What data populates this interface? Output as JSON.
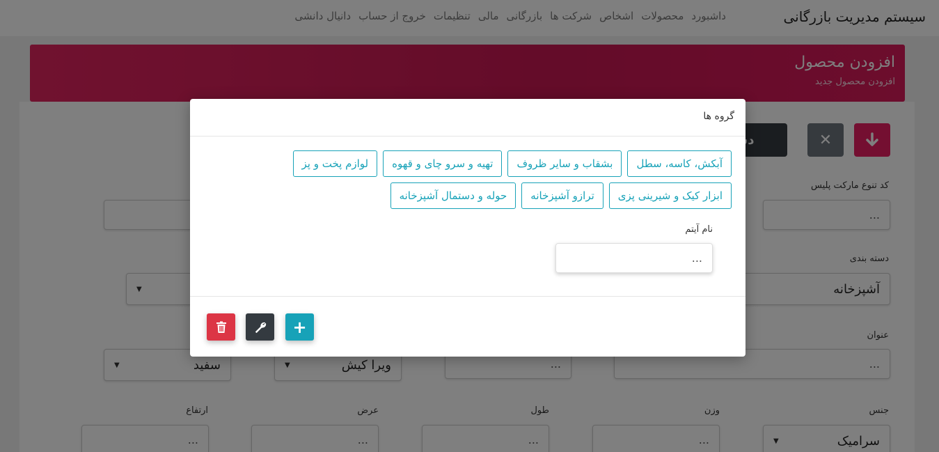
{
  "app": {
    "title": "سیستم مدیریت بازرگانی"
  },
  "nav": {
    "items": [
      "داشبورد",
      "محصولات",
      "اشخاص",
      "شرکت ها",
      "بازرگانی",
      "مالی",
      "تنظیمات",
      "خروج از حساب",
      "دانیال دانشی"
    ]
  },
  "header": {
    "title": "افزودن محصول",
    "subtitle": "افزودن محصول جدید"
  },
  "toolbar": {
    "category_label": "دسته بندی"
  },
  "form": {
    "marketplace_code_label": "کد تنوع مارکت پلیس",
    "marketplace_code_placeholder": "...",
    "category_label": "دسته بندی",
    "category_value": "آشپزخانه",
    "title_label": "عنوان",
    "title_placeholder": "...",
    "mid_placeholder": "...",
    "brand_value": "ویرا کیش",
    "color_value": "سفید",
    "material_label": "جنس",
    "material_value": "سرامیک",
    "weight_label": "وزن",
    "length_label": "طول",
    "width_label": "عرض",
    "height_label": "ارتفاع",
    "weight_placeholder": "...",
    "length_placeholder": "...",
    "width_placeholder": "...",
    "height_placeholder": "..."
  },
  "modal": {
    "title": "گروه ها",
    "groups_row1": [
      "آبکش، کاسه، سطل",
      "بشقاب و سایر ظروف",
      "تهیه و سرو چای و قهوه",
      "لوازم پخت و پز"
    ],
    "groups_row2": [
      "ابزار کیک و شیرینی پزی",
      "ترازو آشپزخانه",
      "حوله و دستمال آشپزخانه"
    ],
    "item_name_label": "نام آیتم",
    "item_name_placeholder": "..."
  },
  "colors": {
    "accent": "#17a2b8",
    "header": "#d81b60",
    "danger": "#dc3545",
    "dark": "#343a40"
  }
}
